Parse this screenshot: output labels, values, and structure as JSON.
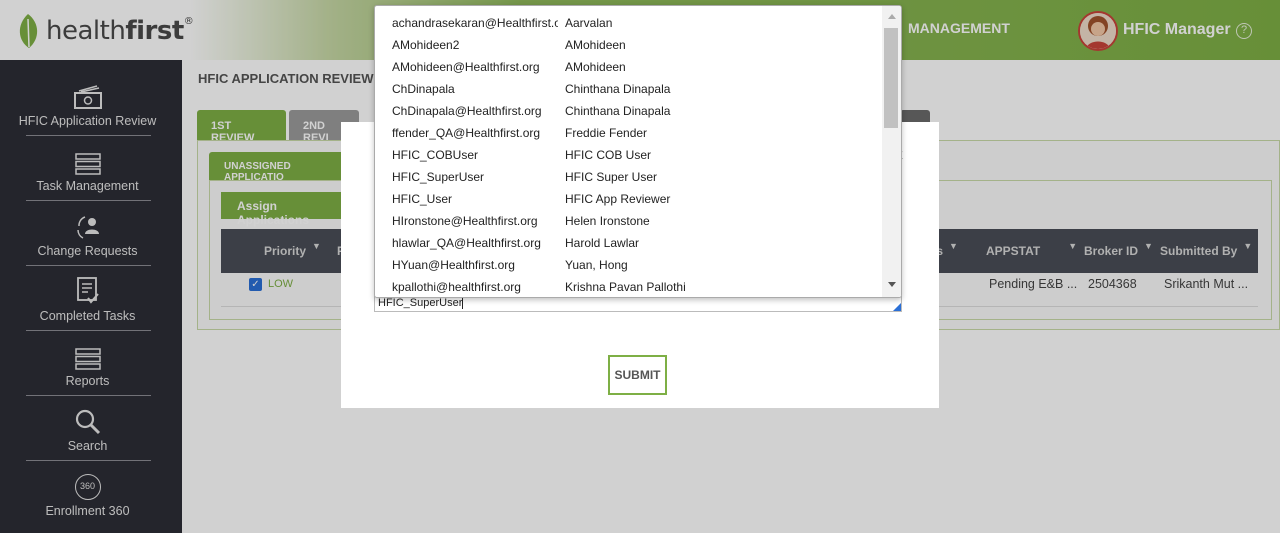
{
  "brand": {
    "logo_light": "health",
    "logo_bold": "first",
    "registered": "®"
  },
  "header": {
    "nav_label": "MANAGEMENT",
    "user_name": "HFIC Manager",
    "help_glyph": "?"
  },
  "colors": {
    "brand_green": "#7eaf45",
    "sidebar_bg": "#2d2e36",
    "table_head_bg": "#4a4e57",
    "check_blue": "#2a6fd6"
  },
  "sidebar": {
    "items": [
      {
        "label": "HFIC Application Review",
        "icon": "money-icon"
      },
      {
        "label": "Task Management",
        "icon": "server-stack-icon"
      },
      {
        "label": "Change Requests",
        "icon": "person-sync-icon"
      },
      {
        "label": "Completed Tasks",
        "icon": "checklist-icon"
      },
      {
        "label": "Reports",
        "icon": "server-stack-icon"
      },
      {
        "label": "Search",
        "icon": "magnifier-icon"
      },
      {
        "label": "Enrollment 360",
        "icon": "360-icon",
        "icon_text": "360"
      }
    ]
  },
  "page": {
    "title": "HFIC APPLICATION REVIEW",
    "tabs": [
      {
        "label": "1ST REVIEW"
      },
      {
        "label": "2ND REVI"
      }
    ],
    "subtab": "UNASSIGNED APPLICATIO",
    "assign_button": "Assign Applications",
    "filter_glyph": "▼",
    "table": {
      "headers": {
        "priority": "Priority",
        "r_col": "P",
        "status_frag": "us",
        "appstat": "APPSTAT",
        "broker": "Broker ID",
        "submitted": "Submitted By"
      },
      "row": {
        "priority": "LOW",
        "appstat": "Pending E&B ...",
        "broker": "2504368",
        "submitted": "Srikanth Mut ..."
      }
    }
  },
  "modal": {
    "input_value": "HFIC_SuperUser",
    "submit_label": "SUBMIT",
    "close_glyph": "x"
  },
  "dropdown": {
    "options": [
      {
        "login": "achandrasekaran@Healthfirst.org",
        "name": "Aarvalan"
      },
      {
        "login": "AMohideen2",
        "name": "AMohideen"
      },
      {
        "login": "AMohideen@Healthfirst.org",
        "name": "AMohideen"
      },
      {
        "login": "ChDinapala",
        "name": "Chinthana Dinapala"
      },
      {
        "login": "ChDinapala@Healthfirst.org",
        "name": "Chinthana Dinapala"
      },
      {
        "login": "ffender_QA@Healthfirst.org",
        "name": "Freddie Fender"
      },
      {
        "login": "HFIC_COBUser",
        "name": "HFIC COB User"
      },
      {
        "login": "HFIC_SuperUser",
        "name": "HFIC Super User"
      },
      {
        "login": "HFIC_User",
        "name": "HFIC App Reviewer"
      },
      {
        "login": "HIronstone@Healthfirst.org",
        "name": "Helen Ironstone"
      },
      {
        "login": "hlawlar_QA@Healthfirst.org",
        "name": "Harold Lawlar"
      },
      {
        "login": "HYuan@Healthfirst.org",
        "name": "Yuan, Hong"
      },
      {
        "login": "kpallothi@healthfirst.org",
        "name": "Krishna Pavan Pallothi"
      }
    ]
  }
}
